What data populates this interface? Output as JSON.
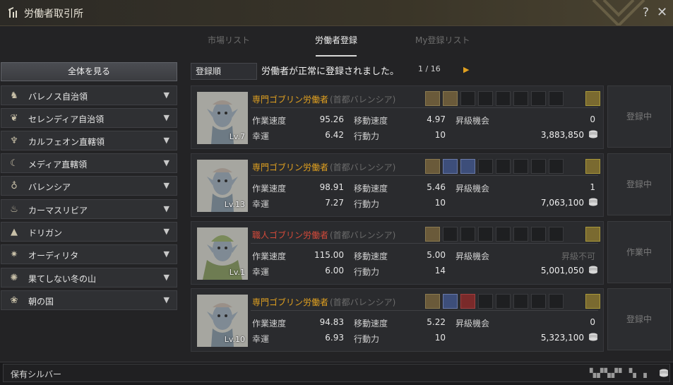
{
  "window": {
    "title": "労働者取引所",
    "help_glyph": "?",
    "close_glyph": "✕"
  },
  "tabs": [
    {
      "label": "市場リスト",
      "active": false
    },
    {
      "label": "労働者登録",
      "active": true
    },
    {
      "label": "My登録リスト",
      "active": false
    }
  ],
  "sidebar": {
    "all_label": "全体を見る",
    "regions": [
      {
        "label": "バレノス自治領",
        "icon": "horse-icon"
      },
      {
        "label": "セレンディア自治領",
        "icon": "bird-icon"
      },
      {
        "label": "カルフェオン直轄領",
        "icon": "eagle-icon"
      },
      {
        "label": "メディア直轄領",
        "icon": "moon-icon"
      },
      {
        "label": "バレンシア",
        "icon": "sun-staff-icon"
      },
      {
        "label": "カーマスリビア",
        "icon": "feather-icon"
      },
      {
        "label": "ドリガン",
        "icon": "mountain-icon"
      },
      {
        "label": "オーディリタ",
        "icon": "star-icon"
      },
      {
        "label": "果てしない冬の山",
        "icon": "snow-sun-icon"
      },
      {
        "label": "朝の国",
        "icon": "flower-icon"
      }
    ]
  },
  "toolbar": {
    "sort_label": "登録順",
    "toast": "労働者が正常に登録されました。",
    "pager": "1 / 16",
    "next_glyph": "▶"
  },
  "labels": {
    "work_speed": "作業速度",
    "move_speed": "移動速度",
    "promotion": "昇級機会",
    "luck": "幸運",
    "stamina": "行動力"
  },
  "workers": [
    {
      "name": "専門ゴブリン労働者",
      "town": "(首都バレンシア)",
      "level": "Lv.7",
      "grade": "gold",
      "work_speed": "95.26",
      "move_speed": "4.97",
      "promotion": "0",
      "luck": "6.42",
      "stamina": "10",
      "price": "3,883,850",
      "action": "登録中",
      "skills": [
        "fill",
        "fill"
      ]
    },
    {
      "name": "専門ゴブリン労働者",
      "town": "(首都バレンシア)",
      "level": "Lv.13",
      "grade": "gold",
      "work_speed": "98.91",
      "move_speed": "5.46",
      "promotion": "1",
      "luck": "7.27",
      "stamina": "10",
      "price": "7,063,100",
      "action": "登録中",
      "skills": [
        "fill",
        "blue",
        "blue"
      ]
    },
    {
      "name": "職人ゴブリン労働者",
      "town": "(首都バレンシア)",
      "level": "Lv.1",
      "grade": "red",
      "work_speed": "115.00",
      "move_speed": "5.00",
      "promotion": "昇級不可",
      "luck": "6.00",
      "stamina": "14",
      "price": "5,001,050",
      "action": "作業中",
      "skills": [
        "fill"
      ]
    },
    {
      "name": "専門ゴブリン労働者",
      "town": "(首都バレンシア)",
      "level": "Lv.10",
      "grade": "gold",
      "work_speed": "94.83",
      "move_speed": "5.22",
      "promotion": "0",
      "luck": "6.93",
      "stamina": "10",
      "price": "5,323,100",
      "action": "登録中",
      "skills": [
        "fill",
        "blue",
        "red"
      ]
    }
  ],
  "footer": {
    "owned_label": "保有シルバー",
    "owned_value": "▚▞▚▞▘▝▖▗"
  },
  "colors": {
    "accent_gold": "#e0a020",
    "artisan_red": "#d44a3a"
  }
}
